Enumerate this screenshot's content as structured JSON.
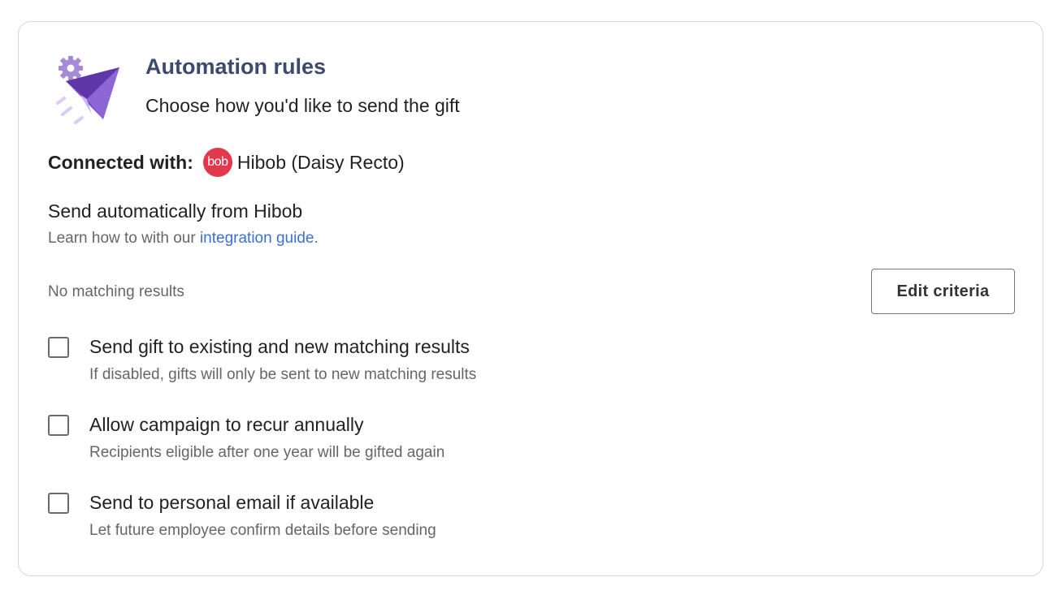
{
  "header": {
    "title": "Automation rules",
    "subtitle": "Choose how you'd like to send the gift",
    "illustration_icon": "paper-plane-gear-icon"
  },
  "connection": {
    "label": "Connected with:",
    "logo_icon": "hibob-logo-icon",
    "logo_text": "bob",
    "value": "Hibob (Daisy Recto)",
    "logo_color": "#e0384d"
  },
  "send_automatically": {
    "title": "Send automatically from Hibob",
    "help_prefix": "Learn how to with our ",
    "help_link": "integration guide",
    "help_suffix": "."
  },
  "results": {
    "status": "No matching results",
    "edit_button": "Edit criteria"
  },
  "options": [
    {
      "label": "Send gift to existing and new matching results",
      "description": "If disabled, gifts will only be sent to new matching results",
      "checked": false
    },
    {
      "label": "Allow campaign to recur annually",
      "description": "Recipients eligible after one year will be gifted again",
      "checked": false
    },
    {
      "label": "Send to personal email if available",
      "description": "Let future employee confirm details before sending",
      "checked": false
    }
  ],
  "colors": {
    "title": "#3d4a6e",
    "link": "#3b6fd8",
    "accent_purple": "#7b4fc4"
  }
}
